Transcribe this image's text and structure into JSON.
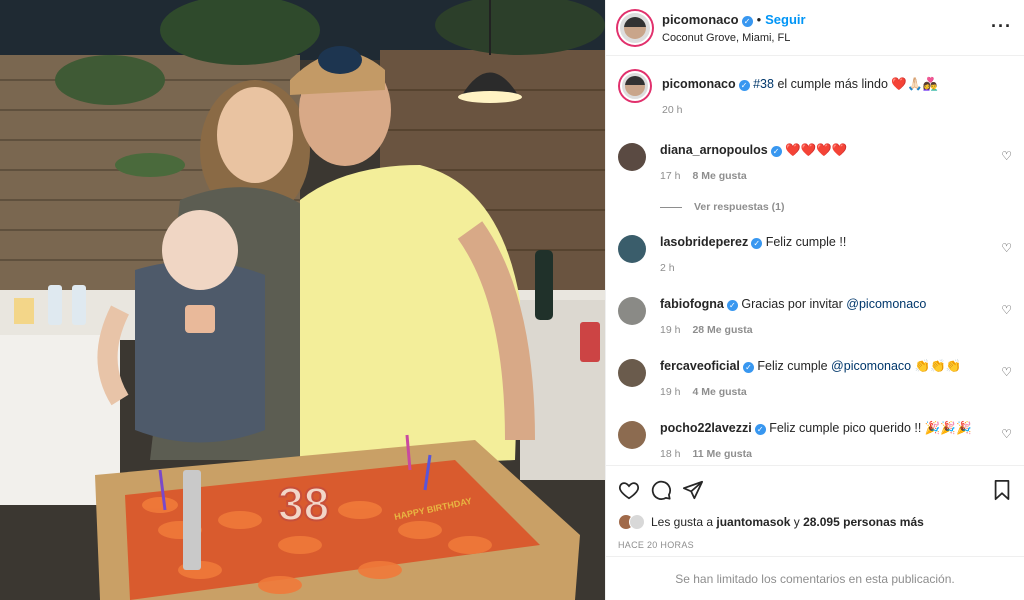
{
  "post": {
    "username": "picomonaco",
    "follow_label": "Seguir",
    "location": "Coconut Grove, Miami, FL",
    "more_label": "···"
  },
  "caption": {
    "username": "picomonaco",
    "hashtag": "#38",
    "text": " el cumple más lindo ❤️🙏🏻👩‍❤️‍👨",
    "time": "20 h"
  },
  "comments": [
    {
      "username": "diana_arnopoulos",
      "verified": true,
      "text": "❤️❤️❤️❤️",
      "mention": "",
      "suffix": "",
      "time": "17 h",
      "likes": "8 Me gusta",
      "replies": "Ver respuestas (1)",
      "avatar_color": "#5a4a42"
    },
    {
      "username": "lasobrideperez",
      "verified": true,
      "text": "Feliz cumple !!",
      "mention": "",
      "suffix": "",
      "time": "2 h",
      "likes": "",
      "avatar_color": "#3a5d6b"
    },
    {
      "username": "fabiofogna",
      "verified": true,
      "text": "Gracias por invitar ",
      "mention": "@picomonaco",
      "suffix": "",
      "time": "19 h",
      "likes": "28 Me gusta",
      "avatar_color": "#8a8a86"
    },
    {
      "username": "fercaveoficial",
      "verified": true,
      "text": "Feliz cumple ",
      "mention": "@picomonaco",
      "suffix": " 👏👏👏",
      "time": "19 h",
      "likes": "4 Me gusta",
      "avatar_color": "#6a5b4c"
    },
    {
      "username": "pocho22lavezzi",
      "verified": true,
      "text": "Feliz cumple pico querido !! 🎉🎉🎉",
      "mention": "",
      "suffix": "",
      "time": "18 h",
      "likes": "11 Me gusta",
      "avatar_color": "#8c6b50"
    }
  ],
  "likes": {
    "prefix": "Les gusta a ",
    "user": "juantomasok",
    "middle": " y ",
    "others": "28.095 personas más"
  },
  "posted_ago": "HACE 20 HORAS",
  "comments_limited": "Se han limitado los comentarios en esta publicación.",
  "photo": {
    "cake_number": "38",
    "cake_text": "HAPPY BIRTHDAY",
    "cap_logo": "panthers-logo-icon"
  },
  "colors": {
    "follow": "#0095f6",
    "verified": "#3897f0",
    "shirt": "#f3ee9a"
  }
}
